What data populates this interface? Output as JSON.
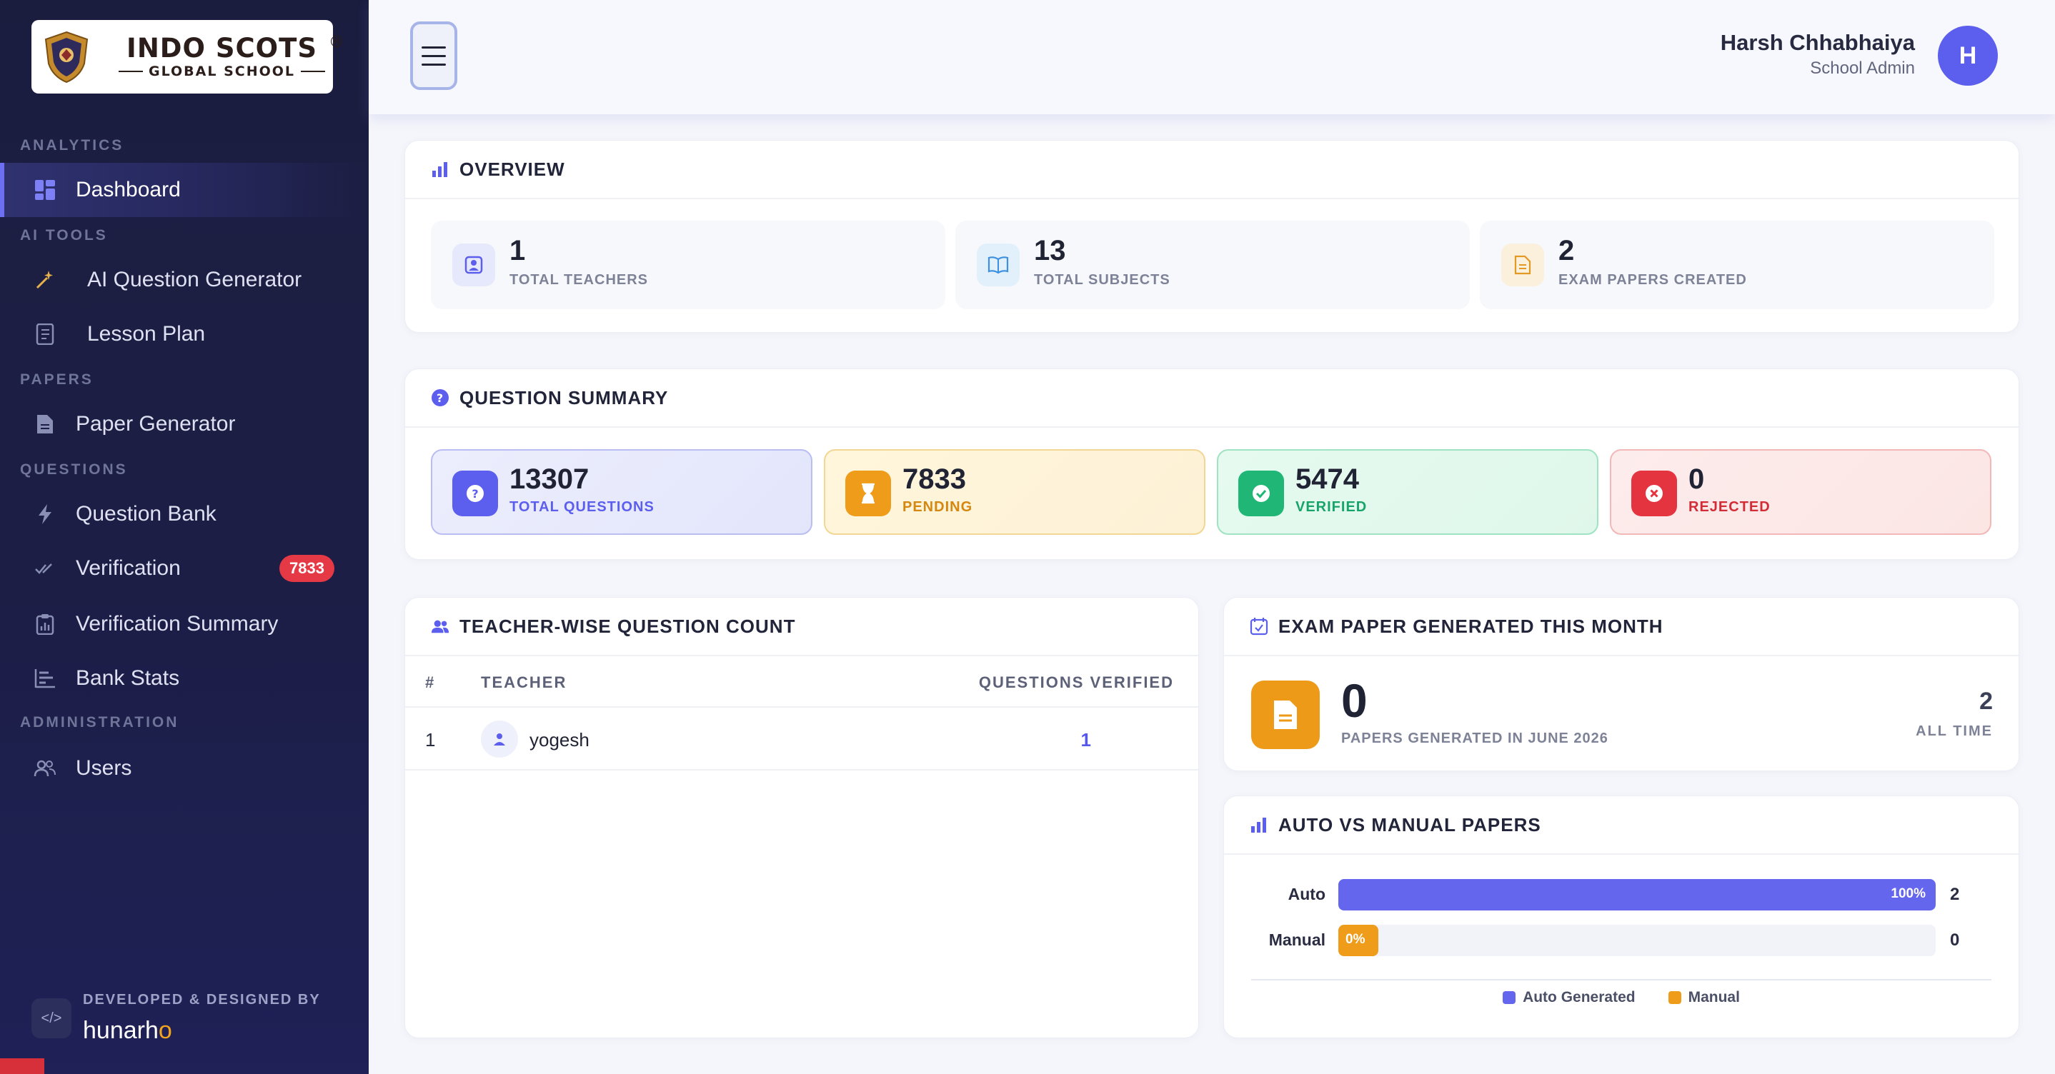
{
  "brand": {
    "name": "INDO SCOTS",
    "subtitle": "GLOBAL SCHOOL",
    "registered": "®"
  },
  "sidebar": {
    "sections": {
      "analytics": "ANALYTICS",
      "ai_tools": "AI TOOLS",
      "papers": "PAPERS",
      "questions": "QUESTIONS",
      "administration": "ADMINISTRATION"
    },
    "items": {
      "dashboard": "Dashboard",
      "ai_question_generator": "AI Question Generator",
      "lesson_plan": "Lesson Plan",
      "paper_generator": "Paper Generator",
      "question_bank": "Question Bank",
      "verification": "Verification",
      "verification_badge": "7833",
      "verification_summary": "Verification Summary",
      "bank_stats": "Bank Stats",
      "users": "Users"
    },
    "footer": {
      "label": "DEVELOPED & DESIGNED BY",
      "brand_a": "hunarh",
      "brand_b": "o"
    }
  },
  "header": {
    "user_name": "Harsh Chhabhaiya",
    "user_role": "School Admin",
    "avatar_initial": "H"
  },
  "overview": {
    "title": "OVERVIEW",
    "tiles": [
      {
        "value": "1",
        "label": "TOTAL TEACHERS"
      },
      {
        "value": "13",
        "label": "TOTAL SUBJECTS"
      },
      {
        "value": "2",
        "label": "EXAM PAPERS CREATED"
      }
    ]
  },
  "question_summary": {
    "title": "QUESTION SUMMARY",
    "tiles": [
      {
        "value": "13307",
        "label": "TOTAL QUESTIONS"
      },
      {
        "value": "7833",
        "label": "PENDING"
      },
      {
        "value": "5474",
        "label": "VERIFIED"
      },
      {
        "value": "0",
        "label": "REJECTED"
      }
    ]
  },
  "teacher_wise": {
    "title": "TEACHER-WISE QUESTION COUNT",
    "columns": {
      "index": "#",
      "teacher": "TEACHER",
      "verified": "QUESTIONS VERIFIED"
    },
    "rows": [
      {
        "index": "1",
        "teacher": "yogesh",
        "verified": "1"
      }
    ]
  },
  "exam_paper": {
    "title": "EXAM PAPER GENERATED THIS MONTH",
    "value": "0",
    "label": "PAPERS GENERATED IN JUNE 2026",
    "all_time_value": "2",
    "all_time_label": "ALL TIME"
  },
  "auto_manual": {
    "title": "AUTO VS MANUAL PAPERS",
    "rows": [
      {
        "label": "Auto",
        "percent_text": "100%",
        "fraction": 1.0,
        "value": "2",
        "color": "#6466ee"
      },
      {
        "label": "Manual",
        "percent_text": "0%",
        "fraction": 0.0,
        "value": "0",
        "color": "#ee9c1a"
      }
    ],
    "legend": {
      "auto": "Auto Generated",
      "manual": "Manual"
    }
  },
  "colors": {
    "accent": "#5c5fee",
    "pending": "#ee9c1a",
    "verified": "#1fb676",
    "rejected": "#e3343f"
  }
}
